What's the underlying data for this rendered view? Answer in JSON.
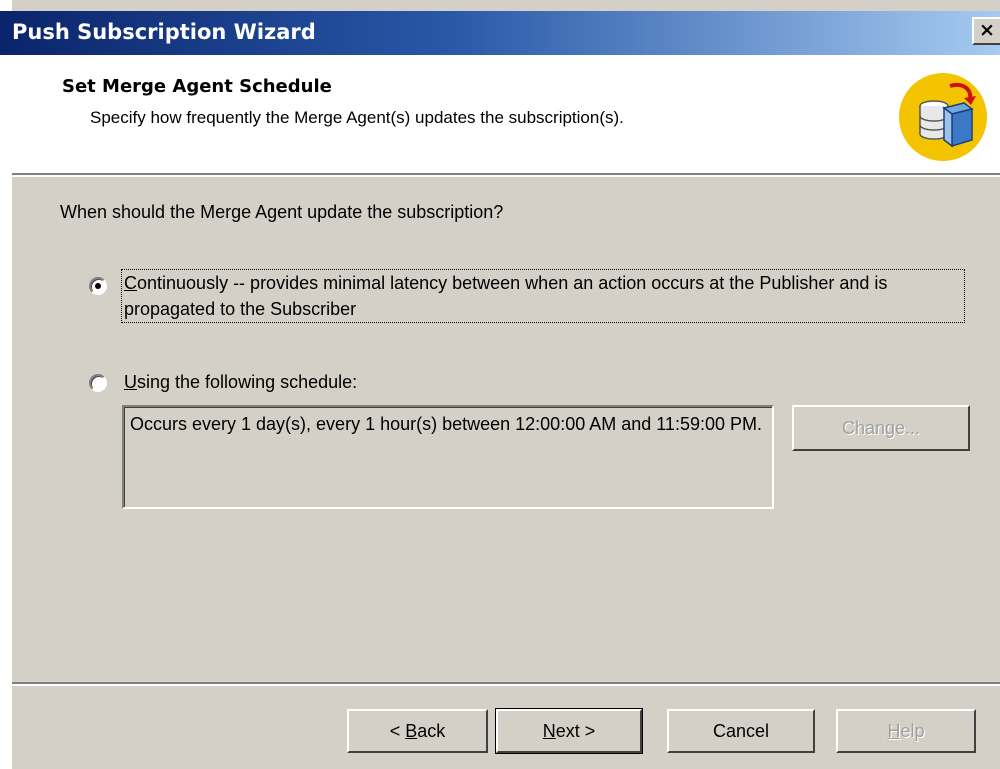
{
  "window": {
    "title": "Push Subscription Wizard",
    "close_label": "×"
  },
  "header": {
    "title": "Set Merge Agent Schedule",
    "subtitle": "Specify how frequently the Merge Agent(s) updates the subscription(s).",
    "icon": "database-sync-icon"
  },
  "question": "When should the Merge Agent update the subscription?",
  "options": [
    {
      "first_char": "C",
      "rest": "ontinuously -- provides minimal latency between when an action occurs at the Publisher and is propagated to the Subscriber",
      "selected": true
    },
    {
      "first_char": "U",
      "rest": "sing the following schedule:",
      "selected": false
    }
  ],
  "schedule_description": "Occurs every 1 day(s), every 1 hour(s) between 12:00:00 AM and 11:59:00 PM.",
  "buttons": {
    "change": {
      "before": "Change",
      "u": "",
      "after": "...",
      "full": "Change...",
      "disabled": true
    },
    "back": {
      "before": "< ",
      "u": "B",
      "after": "ack"
    },
    "next": {
      "before": "",
      "u": "N",
      "after": "ext >"
    },
    "cancel": {
      "label": "Cancel"
    },
    "help": {
      "before": "",
      "u": "H",
      "after": "elp",
      "disabled": true
    }
  },
  "colors": {
    "title_gradient_start": "#0a246a",
    "title_gradient_end": "#a6caf0",
    "face": "#d4d0c8",
    "icon_bg": "#f5c400"
  }
}
